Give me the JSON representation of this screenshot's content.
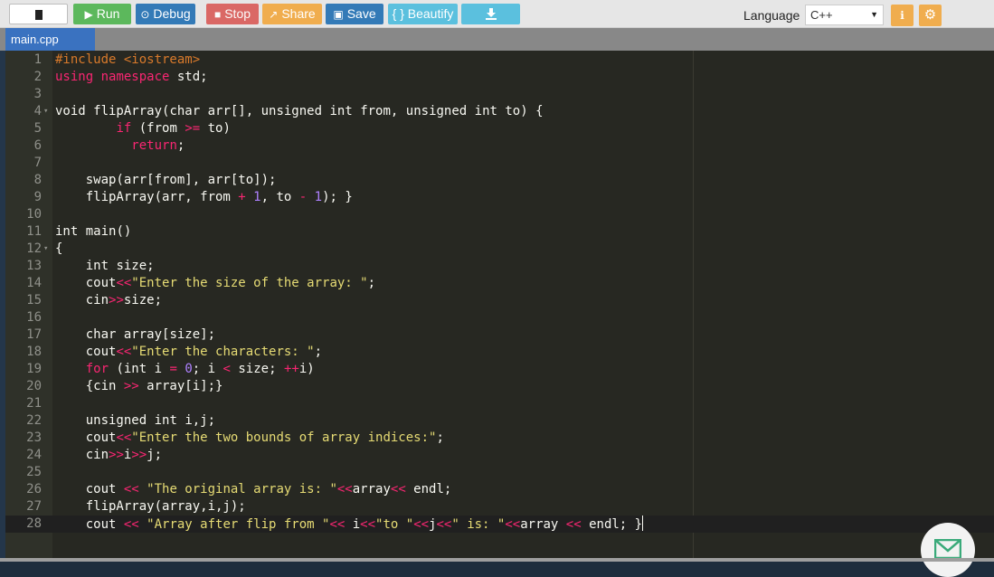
{
  "toolbar": {
    "run_label": "Run",
    "debug_label": "Debug",
    "stop_label": "Stop",
    "share_label": "Share",
    "save_label": "Save",
    "beautify_label": "{ } Beautify",
    "language_label": "Language",
    "language_value": "C++"
  },
  "tabs": [
    {
      "label": "main.cpp"
    }
  ],
  "colors": {
    "run": "#5cb85c",
    "debug": "#337ab7",
    "stop": "#d9534f",
    "share": "#f0ad4e",
    "beautify": "#5bc0de",
    "editor_bg": "#272822"
  },
  "editor": {
    "code_lines": [
      "#include <iostream>",
      "using namespace std;",
      "",
      "void flipArray(char arr[], unsigned int from, unsigned int to) {",
      "        if (from >= to)",
      "          return;",
      "",
      "    swap(arr[from], arr[to]);",
      "    flipArray(arr, from + 1, to - 1); }",
      "",
      "int main()",
      "{",
      "    int size;",
      "    cout<<\"Enter the size of the array: \";",
      "    cin>>size;",
      "",
      "    char array[size];",
      "    cout<<\"Enter the characters: \";",
      "    for (int i = 0; i < size; ++i)",
      "    {cin >> array[i];}",
      "",
      "    unsigned int i,j;",
      "    cout<<\"Enter the two bounds of array indices:\";",
      "    cin>>i>>j;",
      "",
      "    cout << \"The original array is: \"<<array<< endl;",
      "    flipArray(array,i,j);",
      "    cout << \"Array after flip from \"<< i<<\"to \"<<j<<\" is: \"<<array << endl; }"
    ]
  }
}
